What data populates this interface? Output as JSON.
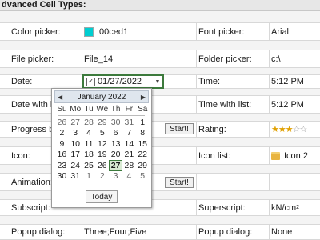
{
  "header": {
    "title": "dvanced Cell Types:"
  },
  "rows": {
    "color": {
      "label": "Color picker:",
      "value": "00ced1",
      "right_label": "Font picker:",
      "right_value": "Arial"
    },
    "file": {
      "label": "File picker:",
      "value": "File_14",
      "right_label": "Folder picker:",
      "right_value": "c:\\"
    },
    "date": {
      "label": "Date:",
      "value": "01/27/2022",
      "right_label": "Time:",
      "right_value": "5:12 PM"
    },
    "datelist": {
      "label": "Date with list",
      "right_label": "Time with list:",
      "right_value": "5:12 PM"
    },
    "progress": {
      "label": "Progress bar",
      "button": "Start!",
      "right_label": "Rating:",
      "rating": 3,
      "rating_max": 5
    },
    "icon": {
      "label": "Icon:",
      "right_label": "Icon list:",
      "right_value": "Icon 2"
    },
    "animation": {
      "label": "Animation:",
      "button": "Start!"
    },
    "subscript": {
      "label": "Subscript:",
      "right_label": "Superscript:",
      "right_value_base": "kN/cm",
      "right_value_sup": "2"
    },
    "popup": {
      "label": "Popup dialog:",
      "value": "Three;Four;Five",
      "right_label": "Popup dialog:",
      "right_value": "None"
    }
  },
  "calendar": {
    "month_label": "January 2022",
    "dow": [
      "Su",
      "Mo",
      "Tu",
      "We",
      "Th",
      "Fr",
      "Sa"
    ],
    "days": [
      {
        "d": "26",
        "o": true
      },
      {
        "d": "27",
        "o": true
      },
      {
        "d": "28",
        "o": true
      },
      {
        "d": "29",
        "o": true
      },
      {
        "d": "30",
        "o": true
      },
      {
        "d": "31",
        "o": true
      },
      {
        "d": "1"
      },
      {
        "d": "2"
      },
      {
        "d": "3"
      },
      {
        "d": "4"
      },
      {
        "d": "5"
      },
      {
        "d": "6"
      },
      {
        "d": "7"
      },
      {
        "d": "8"
      },
      {
        "d": "9"
      },
      {
        "d": "10"
      },
      {
        "d": "11"
      },
      {
        "d": "12"
      },
      {
        "d": "13"
      },
      {
        "d": "14"
      },
      {
        "d": "15"
      },
      {
        "d": "16"
      },
      {
        "d": "17"
      },
      {
        "d": "18"
      },
      {
        "d": "19"
      },
      {
        "d": "20"
      },
      {
        "d": "21"
      },
      {
        "d": "22"
      },
      {
        "d": "23"
      },
      {
        "d": "24"
      },
      {
        "d": "25"
      },
      {
        "d": "26"
      },
      {
        "d": "27",
        "sel": true
      },
      {
        "d": "28"
      },
      {
        "d": "29"
      },
      {
        "d": "30"
      },
      {
        "d": "31"
      },
      {
        "d": "1",
        "o": true
      },
      {
        "d": "2",
        "o": true
      },
      {
        "d": "3",
        "o": true
      },
      {
        "d": "4",
        "o": true
      },
      {
        "d": "5",
        "o": true
      }
    ],
    "today_label": "Today"
  },
  "colors": {
    "swatch": "#00ced1",
    "accent": "#3c7a3c"
  }
}
